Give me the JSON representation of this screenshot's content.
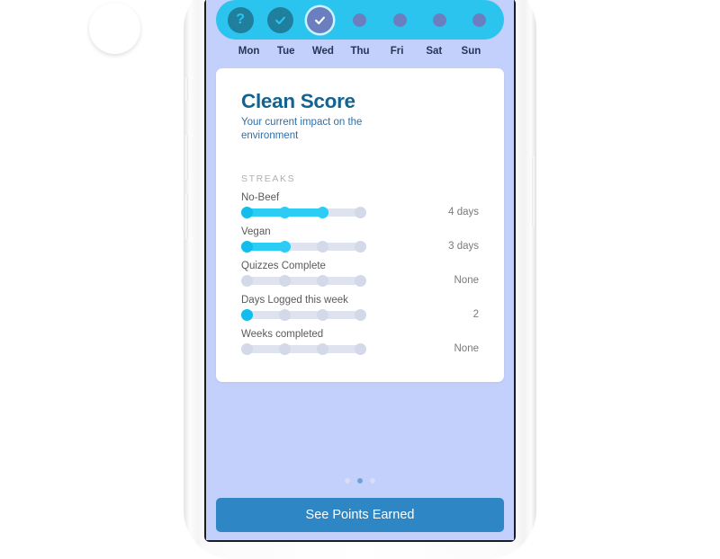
{
  "theme": {
    "screen_bg": "#c3d0fb",
    "week_bar": "#2bc4ef",
    "card_bg": "#ffffff",
    "title_color": "#14628f",
    "subtitle_color": "#2f6fa8",
    "progress_fill": "#2ccdf5",
    "progress_track": "#dfe3ef",
    "cta_color": "#2e87c4",
    "day_dot_color": "#6b7fc0",
    "day_done_color": "#1f7f9c",
    "today_ring_color": "#c9f4ff"
  },
  "week": {
    "days": [
      {
        "label": "Mon",
        "state": "question",
        "icon": "question-mark-icon"
      },
      {
        "label": "Tue",
        "state": "complete",
        "icon": "check-icon"
      },
      {
        "label": "Wed",
        "state": "today",
        "icon": "check-icon"
      },
      {
        "label": "Thu",
        "state": "upcoming",
        "icon": "dot-icon"
      },
      {
        "label": "Fri",
        "state": "upcoming",
        "icon": "dot-icon"
      },
      {
        "label": "Sat",
        "state": "upcoming",
        "icon": "dot-icon"
      },
      {
        "label": "Sun",
        "state": "upcoming",
        "icon": "dot-icon"
      }
    ]
  },
  "card": {
    "title": "Clean Score",
    "subtitle": "Your current impact on the environment",
    "section_label": "STREAKS",
    "streaks": [
      {
        "name": "No-Beef",
        "value": "4 days",
        "filled_nodes": 3,
        "total_nodes": 4
      },
      {
        "name": "Vegan",
        "value": "3 days",
        "filled_nodes": 2,
        "total_nodes": 4
      },
      {
        "name": "Quizzes Complete",
        "value": "None",
        "filled_nodes": 0,
        "total_nodes": 4
      },
      {
        "name": "Days Logged this week",
        "value": "2",
        "filled_nodes": 1,
        "total_nodes": 4
      },
      {
        "name": "Weeks completed",
        "value": "None",
        "filled_nodes": 0,
        "total_nodes": 4
      }
    ]
  },
  "footer": {
    "cta_label": "See Points Earned",
    "page_count": 3,
    "active_page": 2
  }
}
